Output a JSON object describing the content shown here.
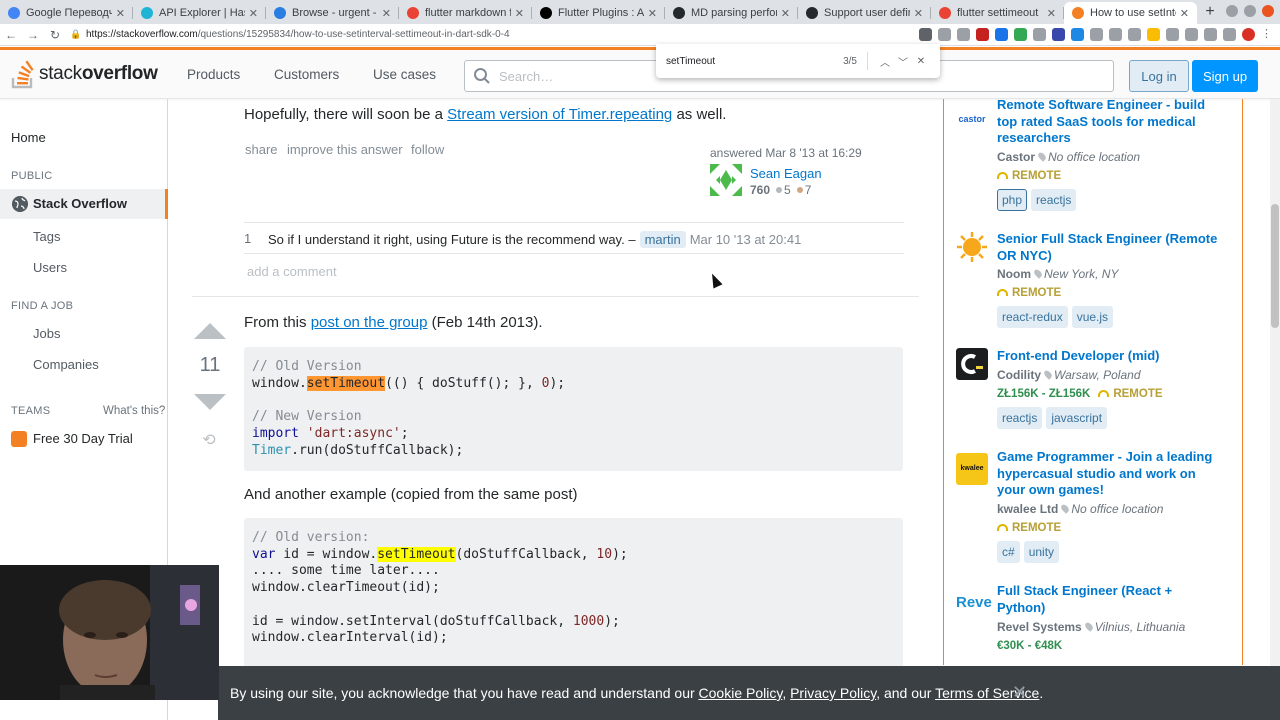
{
  "browser": {
    "tabs": [
      {
        "title": "Google Переводчик",
        "fav_color": "#4285f4"
      },
      {
        "title": "API Explorer | Hasura",
        "fav_color": "#1eb4d4"
      },
      {
        "title": "Browse - urgent - D",
        "fav_color": "#2a7de1"
      },
      {
        "title": "flutter markdown f",
        "fav_color": "#ea4335"
      },
      {
        "title": "Flutter Plugins : As",
        "fav_color": "#000000"
      },
      {
        "title": "MD parsing perfor",
        "fav_color": "#24292e"
      },
      {
        "title": "Support user defin",
        "fav_color": "#24292e"
      },
      {
        "title": "flutter settimeout",
        "fav_color": "#ea4335"
      },
      {
        "title": "How to use setInte",
        "fav_color": "#f48024",
        "active": true
      }
    ],
    "new_tab": "+",
    "url_host": "https://stackoverflow.com",
    "url_path": "/questions/15295834/how-to-use-setinterval-settimeout-in-dart-sdk-0-4"
  },
  "find_bar": {
    "query": "setTimeout",
    "count": "3/5"
  },
  "header": {
    "logo_light": "stack",
    "logo_bold": "overflow",
    "nav": [
      "Products",
      "Customers",
      "Use cases"
    ],
    "search_placeholder": "Search…",
    "login": "Log in",
    "signup": "Sign up"
  },
  "left_nav": {
    "home": "Home",
    "public": "PUBLIC",
    "stack_overflow": "Stack Overflow",
    "tags": "Tags",
    "users": "Users",
    "find_a_job": "FIND A JOB",
    "jobs": "Jobs",
    "companies": "Companies",
    "teams": "TEAMS",
    "whats_this": "What's this?",
    "free_trial": "Free 30 Day Trial"
  },
  "answer1": {
    "text_before": "Hopefully, there will soon be a ",
    "link": "Stream version of Timer.repeating",
    "text_after": " as well.",
    "menu": [
      "share",
      "improve this answer",
      "follow"
    ],
    "answered": "answered Mar 8 '13 at 16:29",
    "user": "Sean Eagan",
    "rep": "760",
    "silver": "5",
    "bronze": "7",
    "comment": {
      "score": "1",
      "text": "So if I understand it right, using Future is the recommend way. –",
      "user": "martin",
      "date": "Mar 10 '13 at 20:41"
    },
    "add_comment": "add a comment"
  },
  "answer2": {
    "votes": "11",
    "intro_before": "From this ",
    "intro_link": "post on the group",
    "intro_after": " (Feb 14th 2013).",
    "second_intro": "And another example (copied from the same post)"
  },
  "jobs": [
    {
      "title": "Remote Software Engineer - build top rated SaaS tools for medical researchers",
      "company": "Castor",
      "location": "No office location",
      "remote": "REMOTE",
      "tags": [
        "php",
        "reactjs"
      ],
      "logo_text": "castor"
    },
    {
      "title": "Senior Full Stack Engineer (Remote OR NYC)",
      "company": "Noom",
      "location": "New York, NY",
      "remote": "REMOTE",
      "tags": [
        "react-redux",
        "vue.js"
      ]
    },
    {
      "title": "Front-end Developer (mid)",
      "company": "Codility",
      "location": "Warsaw, Poland",
      "salary": "ZŁ156K - ZŁ156K",
      "remote": "REMOTE",
      "tags": [
        "reactjs",
        "javascript"
      ]
    },
    {
      "title": "Game Programmer - Join a leading hypercasual studio and work on your own games!",
      "company": "kwalee Ltd",
      "location": "No office location",
      "remote": "REMOTE",
      "tags": [
        "c#",
        "unity"
      ],
      "logo_text": "kwalee"
    },
    {
      "title": "Full Stack Engineer (React + Python)",
      "company": "Revel Systems",
      "location": "Vilnius, Lithuania",
      "salary": "€30K - €48K",
      "logo_text": "Reve"
    }
  ],
  "cookie": {
    "text": "By using our site, you acknowledge that you have read and understand our ",
    "cookie_policy": "Cookie Policy",
    "comma": ", ",
    "privacy_policy": "Privacy Policy",
    "and_our": ", and our ",
    "terms": "Terms of Service",
    "period": "."
  }
}
